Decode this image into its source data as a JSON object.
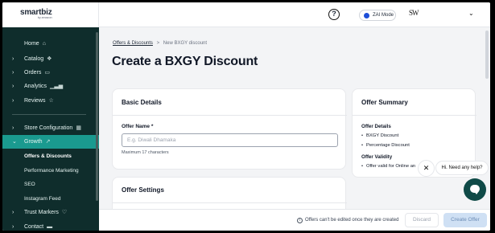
{
  "header": {
    "logo_text": "smartbiz",
    "logo_sub": "by amazon",
    "help_glyph": "?",
    "zai_mode_label": "ZAI Mode",
    "store_logo_text": "SW",
    "account_chevron": "⌄"
  },
  "sidebar": {
    "items": [
      {
        "label": "Home",
        "icon": "home-icon",
        "glyph": "⌂",
        "chevron": ""
      },
      {
        "label": "Catalog",
        "icon": "catalog-icon",
        "glyph": "❖",
        "chevron": "›"
      },
      {
        "label": "Orders",
        "icon": "orders-icon",
        "glyph": "▭",
        "chevron": "›"
      },
      {
        "label": "Analytics",
        "icon": "analytics-icon",
        "glyph": "▁▃▅",
        "chevron": "›"
      },
      {
        "label": "Reviews",
        "icon": "star-icon",
        "glyph": "☆",
        "chevron": "›"
      },
      {
        "label": "Store Configuration",
        "icon": "store-icon",
        "glyph": "▦",
        "chevron": "›"
      },
      {
        "label": "Growth",
        "icon": "growth-icon",
        "glyph": "↗",
        "chevron": "⌄"
      },
      {
        "label": "Trust Markers",
        "icon": "shield-icon",
        "glyph": "♡",
        "chevron": "›"
      },
      {
        "label": "Contact",
        "icon": "chat-icon",
        "glyph": "▬",
        "chevron": "›"
      }
    ],
    "growth_sub": [
      {
        "label": "Offers & Discounts",
        "current": true
      },
      {
        "label": "Performance Marketing",
        "current": false
      },
      {
        "label": "SEO",
        "current": false
      },
      {
        "label": "Instagram Feed",
        "current": false
      }
    ]
  },
  "breadcrumb": {
    "parent": "Offers & Discounts",
    "separator": ">",
    "current": "New BXGY discount"
  },
  "page_title": "Create a BXGY Discount",
  "basic_details": {
    "title": "Basic Details",
    "offer_name_label": "Offer Name *",
    "offer_name_placeholder": "E.g. Diwali Dhamaka",
    "offer_name_value": "",
    "helper": "Maximum 17 characters"
  },
  "offer_settings": {
    "title": "Offer Settings"
  },
  "offer_summary": {
    "title": "Offer Summary",
    "details_heading": "Offer Details",
    "details": [
      "BXGY Discount",
      "Percentage Discount"
    ],
    "validity_heading": "Offer Validity",
    "validity": [
      "Offer valid for Online an"
    ]
  },
  "chat": {
    "close_glyph": "✕",
    "prompt": "Hi. Need any help?"
  },
  "footer": {
    "info_glyph": "i",
    "note": "Offers can't be edited once they are created",
    "discard_label": "Discard",
    "create_label": "Create Offer"
  },
  "colors": {
    "sidebar_bg": "#0f2d2c",
    "sidebar_active": "#1a9a8f",
    "create_button_bg": "#cfe0f4",
    "chat_fab": "#0f4a47"
  }
}
